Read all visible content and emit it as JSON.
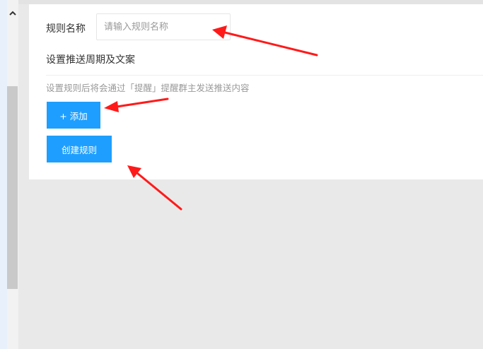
{
  "form": {
    "rule_name_label": "规则名称",
    "rule_name_placeholder": "请输入规则名称",
    "rule_name_value": "",
    "section_title": "设置推送周期及文案",
    "hint": "设置规则后将会通过「提醒」提醒群主发送推送内容",
    "add_button": "+ 添加",
    "create_button": "创建规则"
  },
  "colors": {
    "primary_button": "#1e9fff",
    "annotation_arrow": "#ff1a1a"
  },
  "icons": {
    "scroll_up": "chevron-up-icon"
  }
}
